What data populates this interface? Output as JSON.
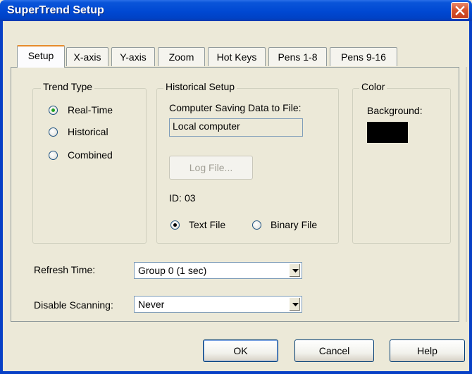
{
  "window": {
    "title": "SuperTrend Setup"
  },
  "tabs": [
    {
      "label": "Setup",
      "active": true
    },
    {
      "label": "X-axis"
    },
    {
      "label": "Y-axis"
    },
    {
      "label": "Zoom"
    },
    {
      "label": "Hot Keys"
    },
    {
      "label": "Pens 1-8"
    },
    {
      "label": "Pens 9-16"
    }
  ],
  "trend_type": {
    "label": "Trend Type",
    "options": [
      {
        "label": "Real-Time",
        "selected": true
      },
      {
        "label": "Historical",
        "selected": false
      },
      {
        "label": "Combined",
        "selected": false
      }
    ]
  },
  "historical_setup": {
    "label": "Historical Setup",
    "computer_label": "Computer Saving Data to File:",
    "computer_value": "Local computer",
    "log_file_button": "Log File...",
    "id_label": "ID:",
    "id_value": "03",
    "file_type": [
      {
        "label": "Text File",
        "selected": true
      },
      {
        "label": "Binary File",
        "selected": false
      }
    ]
  },
  "color": {
    "label": "Color",
    "background_label": "Background:",
    "background_color": "#000000"
  },
  "refresh_time": {
    "label": "Refresh Time:",
    "value": "Group 0 (1 sec)"
  },
  "disable_scanning": {
    "label": "Disable Scanning:",
    "value": "Never"
  },
  "buttons": {
    "ok": "OK",
    "cancel": "Cancel",
    "help": "Help"
  },
  "icons": {
    "close": "close-icon",
    "dropdown": "chevron-down-icon"
  }
}
